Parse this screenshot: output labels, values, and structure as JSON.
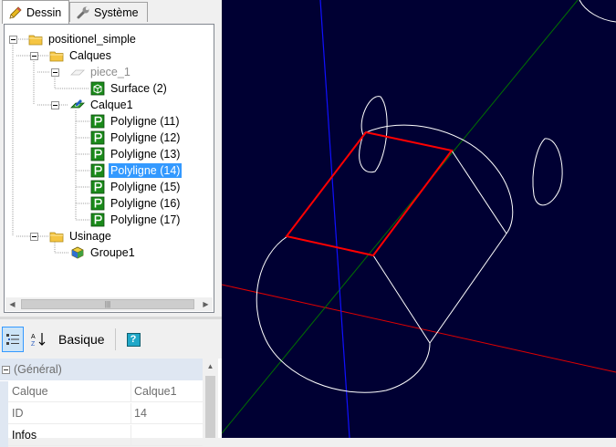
{
  "tabs": [
    {
      "label": "Dessin",
      "icon": "pencil-icon",
      "active": true
    },
    {
      "label": "Système",
      "icon": "wrench-icon",
      "active": false
    }
  ],
  "tree": {
    "root": "positionel_simple",
    "calques": "Calques",
    "piece": "piece_1",
    "surface": "Surface (2)",
    "calque1": "Calque1",
    "polylignes": [
      "Polyligne (11)",
      "Polyligne (12)",
      "Polyligne (13)",
      "Polyligne (14)",
      "Polyligne (15)",
      "Polyligne (16)",
      "Polyligne (17)"
    ],
    "selected": "Polyligne (14)",
    "usinage": "Usinage",
    "groupe": "Groupe1"
  },
  "property_toolbar": {
    "basique_label": "Basique",
    "help_label": "?"
  },
  "property_grid": {
    "category": "(Général)",
    "rows": [
      {
        "name": "Calque",
        "value": "Calque1"
      },
      {
        "name": "ID",
        "value": "14"
      },
      {
        "name": "Infos",
        "value": ""
      }
    ]
  },
  "colors": {
    "viewport_bg": "#000033",
    "selection": "#3399ff",
    "axis_x": "#e00000",
    "axis_y": "#1010ff",
    "axis_z": "#007000",
    "highlight": "#ff0000",
    "wire": "#ffffff"
  }
}
